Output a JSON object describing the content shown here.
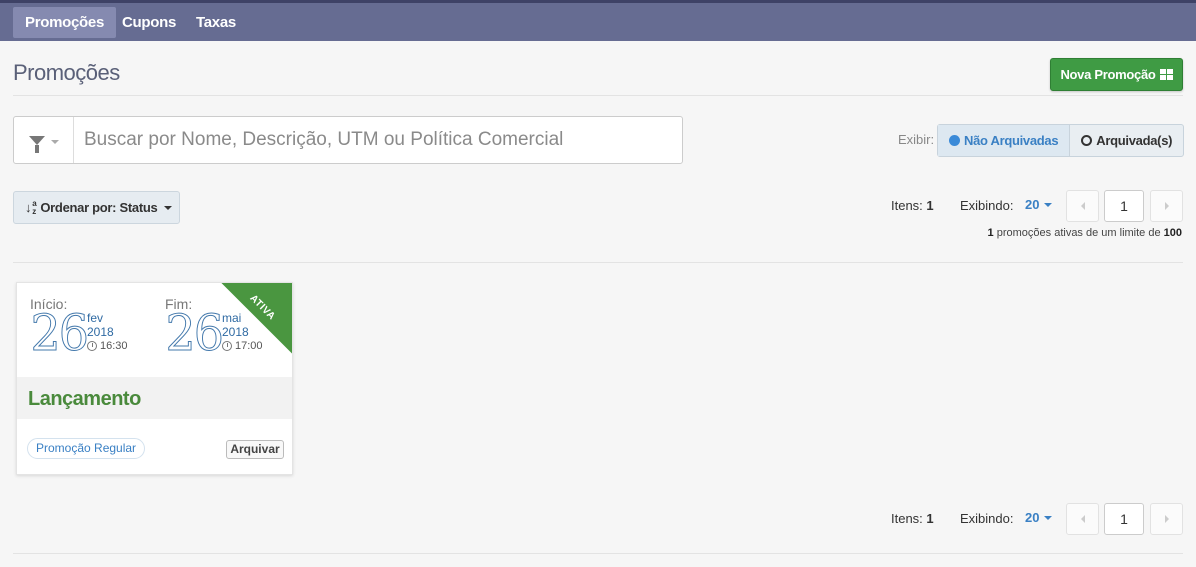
{
  "nav": {
    "tabs": [
      {
        "label": "Promoções",
        "active": true
      },
      {
        "label": "Cupons"
      },
      {
        "label": "Taxas"
      }
    ]
  },
  "header": {
    "title": "Promoções",
    "new_button": "Nova Promoção"
  },
  "search": {
    "placeholder": "Buscar por Nome, Descrição, UTM ou Política Comercial",
    "value": ""
  },
  "view_filter": {
    "label": "Exibir:",
    "options": [
      "Não Arquivadas",
      "Arquivada(s)"
    ],
    "selected": "Não Arquivadas"
  },
  "sort": {
    "label": "Ordenar por: Status"
  },
  "pagination_top": {
    "items_label": "Itens:",
    "items_count": "1",
    "showing_label": "Exibindo:",
    "page_size": "20",
    "page": "1"
  },
  "pagination_bottom": {
    "items_label": "Itens:",
    "items_count": "1",
    "showing_label": "Exibindo:",
    "page_size": "20",
    "page": "1"
  },
  "limit_note": {
    "active": "1",
    "text_mid": " promoções ativas de um limite de ",
    "limit": "100"
  },
  "promotions": [
    {
      "start": {
        "label": "Início:",
        "day": "26",
        "month": "fev",
        "year": "2018",
        "time": "16:30"
      },
      "end": {
        "label": "Fim:",
        "day": "26",
        "month": "mai",
        "year": "2018",
        "time": "17:00"
      },
      "status": "ATIVA",
      "name": "Lançamento",
      "type": "Promoção Regular",
      "archive_label": "Arquivar"
    }
  ],
  "colors": {
    "nav_bg": "#666c92",
    "primary_green": "#3f9b44",
    "accent_blue": "#3a80c4"
  }
}
